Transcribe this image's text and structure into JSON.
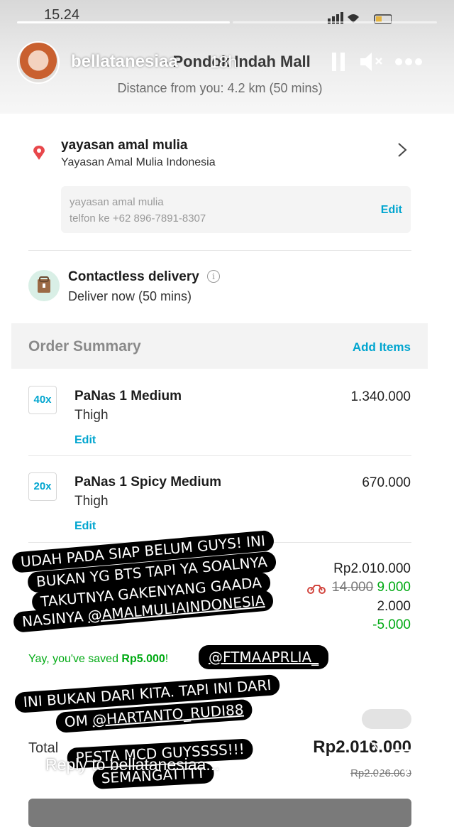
{
  "story": {
    "status_time": "15.24",
    "username": "bellatanesiaa",
    "time_ago": "18h",
    "merchant_partial": "- Pondok Indah Mall",
    "distance": "Distance from you: 4.2 km (50 mins)"
  },
  "address": {
    "title": "yayasan amal mulia",
    "subtitle": "Yayasan Amal Mulia Indonesia",
    "note_line1": "yayasan amal mulia",
    "note_line2": "telfon ke +62 896-7891-8307",
    "edit_label": "Edit"
  },
  "delivery": {
    "title": "Contactless delivery",
    "subtitle": "Deliver now (50 mins)",
    "info_glyph": "i"
  },
  "order_summary": {
    "title": "Order Summary",
    "add_items": "Add Items",
    "items": [
      {
        "qty": "40x",
        "name": "PaNas 1 Medium",
        "variant": "Thigh",
        "edit": "Edit",
        "price": "1.340.000"
      },
      {
        "qty": "20x",
        "name": "PaNas 1 Spicy Medium",
        "variant": "Thigh",
        "edit": "Edit",
        "price": "670.000"
      }
    ]
  },
  "breakdown": {
    "subtotal": "Rp2.010.000",
    "delivery_old": "14.000",
    "delivery_new": "9.000",
    "fee": "2.000",
    "discount": "-5.000",
    "saved_prefix": "Yay, you've saved ",
    "saved_amount": "Rp5.000",
    "saved_suffix": "!"
  },
  "total": {
    "label": "Total",
    "value": "Rp2.016.000",
    "old_value": "Rp2.026.000"
  },
  "stickers": {
    "s1_line1": "UDAH PADA SIAP BELUM GUYS! INI",
    "s1_line2": "BUKAN YG BTS TAPI YA SOALNYA",
    "s1_line3": "TAKUTNYA GAKENYANG GAADA",
    "s1_line4_prefix": "NASINYA ",
    "s1_line4_mention": "@AMALMULIAINDONESIA",
    "s2_mention": "@FTMAAPRLIA_",
    "s3_line1": "INI BUKAN DARI KITA. TAPI INI DARI",
    "s3_line2_prefix": "OM ",
    "s3_line2_mention": "@HARTANTO_RUDI88",
    "s4_line1": "PESTA MCD GUYSSSS!!!",
    "s4_line2": "SEMANGATTTT"
  },
  "reply": {
    "placeholder": "Reply to bellatanesiaa..."
  },
  "colors": {
    "accent": "#00a5cf",
    "green": "#00aa13",
    "pin": "#e8474b"
  }
}
